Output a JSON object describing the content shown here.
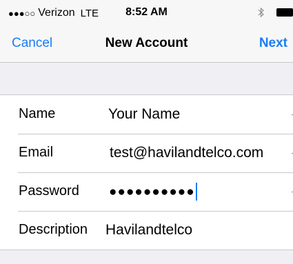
{
  "status_bar": {
    "signal": "●●●○○",
    "carrier": "Verizon",
    "network": "LTE",
    "time": "8:52 AM",
    "bluetooth_icon": "bluetooth-icon",
    "battery_icon": "battery-icon"
  },
  "nav": {
    "cancel_label": "Cancel",
    "title": "New Account",
    "next_label": "Next"
  },
  "form": {
    "name": {
      "label": "Name",
      "placeholder": "Your Name",
      "value": ""
    },
    "email": {
      "label": "Email",
      "value": "test@havilandtelco.com"
    },
    "password": {
      "label": "Password",
      "masked_value": "●●●●●●●●●●"
    },
    "description": {
      "label": "Description",
      "value": "Havilandtelco"
    }
  },
  "colors": {
    "accent": "#1a7cf5",
    "background": "#efeff4",
    "separator": "#c8c7cc"
  }
}
